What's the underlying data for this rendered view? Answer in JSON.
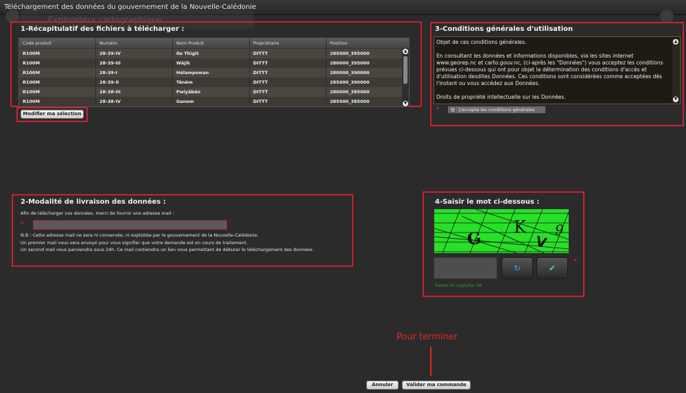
{
  "window": {
    "title": "Téléchargement des données du gouvernement de la Nouvelle-Calédonie",
    "background_title": "Explorateur cartographique"
  },
  "section1": {
    "title": "1-Récapitulatif des fichiers à télécharger :",
    "columns": [
      "Code produit",
      "Numéro",
      "Nom Produit",
      "Propriétaire",
      "Position"
    ],
    "rows": [
      [
        "R100M",
        "28-39-IV",
        "Ile Thigit",
        "DITTT",
        "285000_395000"
      ],
      [
        "R100M",
        "28-39-III",
        "Wâjik",
        "DITTT",
        "280000_395000"
      ],
      [
        "R100M",
        "28-39-I",
        "Hélampowan",
        "DITTT",
        "280000_390000"
      ],
      [
        "R100M",
        "28-39-II",
        "Tênêm",
        "DITTT",
        "285000_390000"
      ],
      [
        "R100M",
        "28-38-III",
        "Pwiyâbên",
        "DITTT",
        "280000_385000"
      ],
      [
        "R100M",
        "28-38-IV",
        "Ganem",
        "DITTT",
        "285000_385000"
      ]
    ],
    "modify_button": "Modifier ma sélection"
  },
  "section2": {
    "title": "2-Modalité de livraison des données :",
    "instruction": "Afin de télécharger vos données, merci de fournir une adresse mail :",
    "required_mark": "*",
    "email_value": "",
    "notes": [
      "N.B : Cette adresse mail ne sera ni conservée, ni exploitée par le gouvernement de la Nouvelle-Calédonie.",
      "Un premier mail vous sera envoyé pour vous signifier que votre demande est en cours de traitement.",
      "Un second mail vous parviendra sous 24h. Ce mail contiendra un lien vous permettant de débuter le téléchargement des données."
    ]
  },
  "section3": {
    "title": "3-Conditions générales d'utilisation",
    "paragraphs": [
      "Objet de ces conditions générales.",
      "En consultant les données et informations disponibles, via les sites internet www.georep.nc et carto.gouv.nc, (ci-après les \"Données\") vous acceptez les conditions prévues ci-dessous qui ont pour objet la détermination des conditions d'accès et d'utilisation desdites Données. Ces conditions sont considérées comme acceptées dès l'instant ou vous accédez aux Données.",
      "Droits de propriété intellectuelle sur les Données."
    ],
    "required_mark": "*",
    "accept_label": "J'accepte les conditions générales",
    "accepted": false
  },
  "section4": {
    "title": "4-Saisir le mot ci-dessous :",
    "captcha_text": "G K V 9",
    "captcha_input": "",
    "required_mark": "*",
    "status": "Saisie du captcha OK",
    "colors": {
      "captcha_bg": "#28e028",
      "status": "#2fa02f"
    }
  },
  "footer": {
    "annotation": "Pour terminer",
    "cancel": "Annuler",
    "submit": "Valider ma commande"
  },
  "colors": {
    "highlight": "#d02030",
    "background": "#2b2b2b"
  }
}
